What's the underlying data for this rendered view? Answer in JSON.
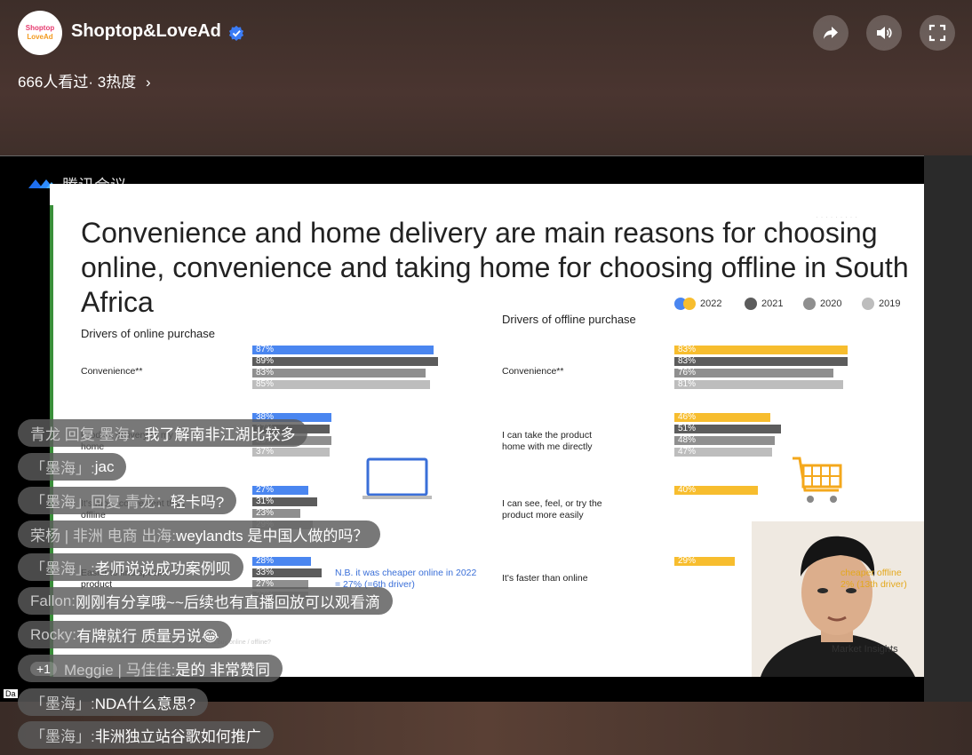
{
  "header": {
    "logo_line1": "Shoptop",
    "logo_line2": "LoveAd",
    "channel_name": "Shoptop&LoveAd",
    "viewer_text": "666人看过· 3热度",
    "chevron": "›"
  },
  "controls": {
    "share_icon": "share-icon",
    "volume_icon": "volume-icon",
    "fullscreen_icon": "fullscreen-icon"
  },
  "meeting": {
    "app_name": "腾讯会议"
  },
  "slide": {
    "title": "Convenience and home delivery are main reasons for choosing online, convenience and taking home for choosing offline in South Africa",
    "online_label": "Drivers of online purchase",
    "offline_label": "Drivers of offline purchase",
    "legend": [
      "2022",
      "2021",
      "2020",
      "2019"
    ],
    "colors": {
      "blue_2022": "#4a86f0",
      "yellow_2022": "#f7bd2e",
      "y2021": "#5c5c5c",
      "y2020": "#8f8f8f",
      "y2019": "#bdbdbd"
    },
    "online_rows": [
      {
        "label": "Convenience**",
        "values": [
          "87%",
          "89%",
          "83%",
          "85%"
        ]
      },
      {
        "label": "Product delivery to my home",
        "values": [
          "38%",
          "37%",
          "38%",
          "37%"
        ]
      },
      {
        "label": "It's more convenient than offline",
        "values": [
          "27%",
          "31%",
          "23%",
          "29%"
        ]
      },
      {
        "label": "Easier to find specific product",
        "values": [
          "28%",
          "33%",
          "27%",
          "27%"
        ]
      }
    ],
    "offline_rows": [
      {
        "label": "Convenience**",
        "values": [
          "83%",
          "83%",
          "76%",
          "81%"
        ]
      },
      {
        "label": "I can take the product home with me directly",
        "values": [
          "46%",
          "51%",
          "48%",
          "47%"
        ]
      },
      {
        "label": "I can see, feel, or try the product more easily",
        "values": [
          "40%"
        ]
      },
      {
        "label": "It's faster than online",
        "values": [
          "29%"
        ]
      }
    ],
    "nb_left": "N.B. it was cheaper online in 2022 = 27% (=6th driver)",
    "nb_right": "cheaper offline\n2% (13th driver)",
    "footer": "Base: ... 2019/2020/2021/2022 ... Q: Why do you buy online / offline?",
    "market_insights": "Market Insights",
    "da_tag": "Da"
  },
  "chat": [
    {
      "who": "青龙 回复 墨海：",
      "text": "我了解南非江湖比较多"
    },
    {
      "who": "「墨海」: ",
      "text": "jac"
    },
    {
      "who": "「墨海」回复 青龙：",
      "text": "轻卡吗?"
    },
    {
      "who": "荣杨 | 非洲 电商 出海: ",
      "text": "weylandts 是中国人做的吗？"
    },
    {
      "who": "「墨海」: ",
      "text": "老师说说成功案例呗"
    },
    {
      "who": "Fallon: ",
      "text": "刚刚有分享哦~~后续也有直播回放可以观看滴"
    },
    {
      "who": "Rocky: ",
      "text": "有牌就行 质量另说😂"
    },
    {
      "plus": "+1",
      "who": "Meggie | 马佳佳: ",
      "text": "是的 非常赞同"
    },
    {
      "who": "「墨海」: ",
      "text": "NDA什么意思?"
    },
    {
      "who": "「墨海」: ",
      "text": "非洲独立站谷歌如何推广"
    }
  ]
}
